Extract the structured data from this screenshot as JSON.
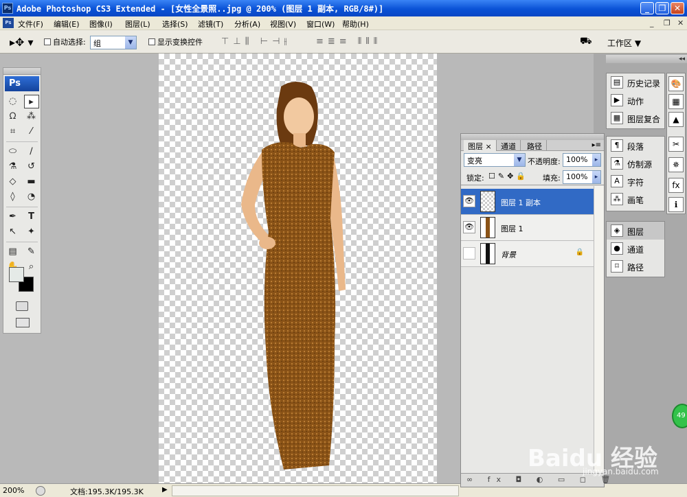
{
  "window": {
    "title": "Adobe Photoshop CS3 Extended - [女性全景照..jpg @ 200% (图层 1 副本, RGB/8#)]",
    "logo": "Ps",
    "buttons": [
      "_",
      "❐",
      "✕"
    ]
  },
  "menu": {
    "logo": "Ps",
    "items": [
      "文件(F)",
      "编辑(E)",
      "图像(I)",
      "图层(L)",
      "选择(S)",
      "滤镜(T)",
      "分析(A)",
      "视图(V)",
      "窗口(W)",
      "帮助(H)"
    ],
    "doc_controls": [
      "_",
      "❐",
      "✕"
    ]
  },
  "options": {
    "auto_select_label": "自动选择:",
    "auto_select_value": "组",
    "show_transform_label": "显示变换控件",
    "workspace_label": "工作区 ▼"
  },
  "toolbox": {
    "logo": "Ps"
  },
  "status": {
    "zoom": "200%",
    "doc": "文档:195.3K/195.3K",
    "play": "▶"
  },
  "layers_panel": {
    "tabs": [
      "图层 ×",
      "通道",
      "路径"
    ],
    "blend_mode": "变亮",
    "opacity_label": "不透明度:",
    "opacity_value": "100%",
    "lock_label": "锁定:",
    "fill_label": "填充:",
    "fill_value": "100%",
    "layers": [
      {
        "name": "图层 1 副本",
        "visible": true,
        "selected": true
      },
      {
        "name": "图层 1",
        "visible": true,
        "selected": false
      },
      {
        "name": "背景",
        "visible": false,
        "selected": false,
        "locked": true
      }
    ],
    "footer": "∞ fx ◘ ◐ ▭ ◻ 🗑"
  },
  "dock": {
    "group1": [
      "历史记录",
      "动作",
      "图层复合"
    ],
    "group2": [
      "段落",
      "仿制源",
      "字符",
      "画笔"
    ],
    "group3": [
      "图层",
      "通道",
      "路径"
    ]
  },
  "watermark": {
    "main": "Baidu 经验",
    "sub": "jingyan.baidu.com",
    "badge": "49"
  },
  "colors": {
    "title_blue": "#0a52d6",
    "selected_layer": "#316ac5",
    "dress": "#8a5317"
  }
}
